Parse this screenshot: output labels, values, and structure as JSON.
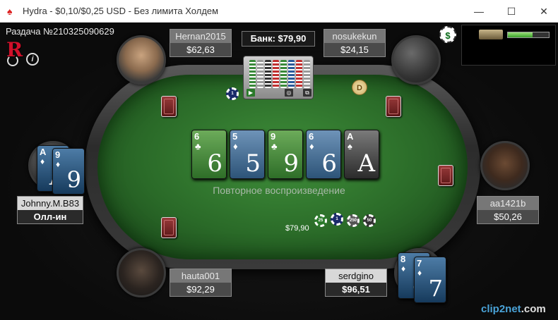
{
  "window": {
    "title": "Hydra - $0,10/$0,25 USD - Без лимита Холдем",
    "minimize": "—",
    "maximize": "☐",
    "close": "✕"
  },
  "hand": {
    "id_label": "Раздача №210325090629"
  },
  "pot": {
    "label": "Банк: $79,90"
  },
  "replay_text": "Повторное воспроизведение",
  "board": [
    {
      "rank": "6",
      "suit": "♣",
      "color": "green"
    },
    {
      "rank": "5",
      "suit": "♦",
      "color": "blue"
    },
    {
      "rank": "9",
      "suit": "♣",
      "color": "green"
    },
    {
      "rank": "6",
      "suit": "♦",
      "color": "blue"
    },
    {
      "rank": "A",
      "suit": "♠",
      "color": "black"
    }
  ],
  "players": {
    "hernan": {
      "name": "Hernan2015",
      "stack": "$62,63"
    },
    "nosukekun": {
      "name": "nosukekun",
      "stack": "$24,15"
    },
    "aa1421b": {
      "name": "aa1421b",
      "stack": "$50,26"
    },
    "serdgino": {
      "name": "serdgino",
      "stack": "$96,51",
      "cards": [
        {
          "rank": "8",
          "suit": "♦"
        },
        {
          "rank": "7",
          "suit": "♦"
        }
      ]
    },
    "hauta": {
      "name": "hauta001",
      "stack": "$92,29"
    },
    "johnny": {
      "name": "Johnny.M.B83",
      "status": "Олл-ин",
      "cards": [
        {
          "rank": "A",
          "suit": "♦"
        },
        {
          "rank": "9",
          "suit": "♦"
        }
      ]
    }
  },
  "bet": {
    "amount": "$79,90"
  },
  "dealer_button": "D",
  "cashier_icon": "$",
  "logo_letter": "R",
  "info_glyph": "i",
  "rack_glyphs": {
    "play": "▶",
    "replay": "◎",
    "windows": "⧉"
  },
  "chip_labels": [
    "25",
    "1",
    "250",
    "50"
  ],
  "center_chip": "1",
  "mini_panel": {
    "progress": 0.6
  },
  "watermark": {
    "main": "clip2net",
    "suffix": ".com"
  }
}
